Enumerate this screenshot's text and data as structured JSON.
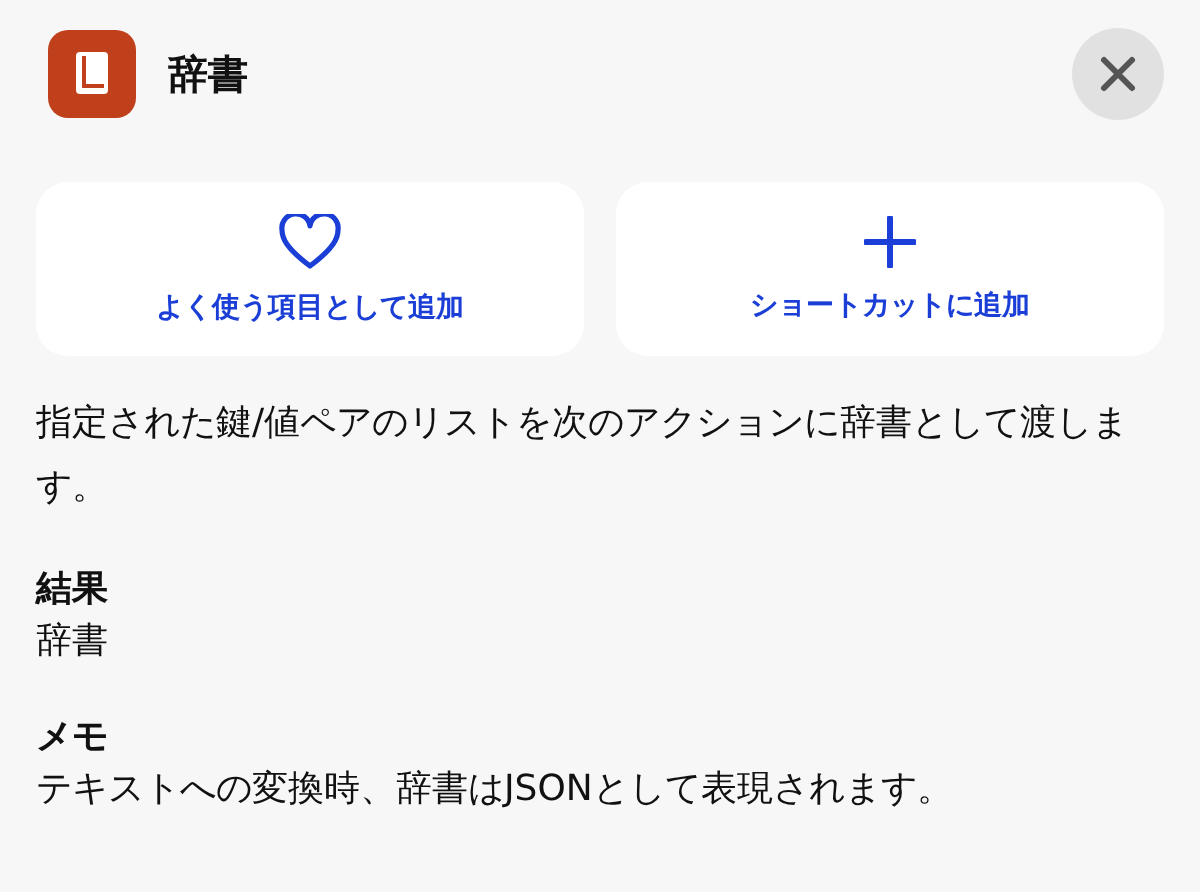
{
  "header": {
    "title": "辞書"
  },
  "actions": [
    {
      "kind": "favorite",
      "label": "よく使う項目として追加"
    },
    {
      "kind": "shortcut",
      "label": "ショートカットに追加"
    }
  ],
  "description": "指定された鍵/値ペアのリストを次のアクションに辞書として渡します。",
  "sections": [
    {
      "heading": "結果",
      "body": "辞書"
    },
    {
      "heading": "メモ",
      "body": "テキストへの変換時、辞書はJSONとして表現されます。"
    }
  ]
}
